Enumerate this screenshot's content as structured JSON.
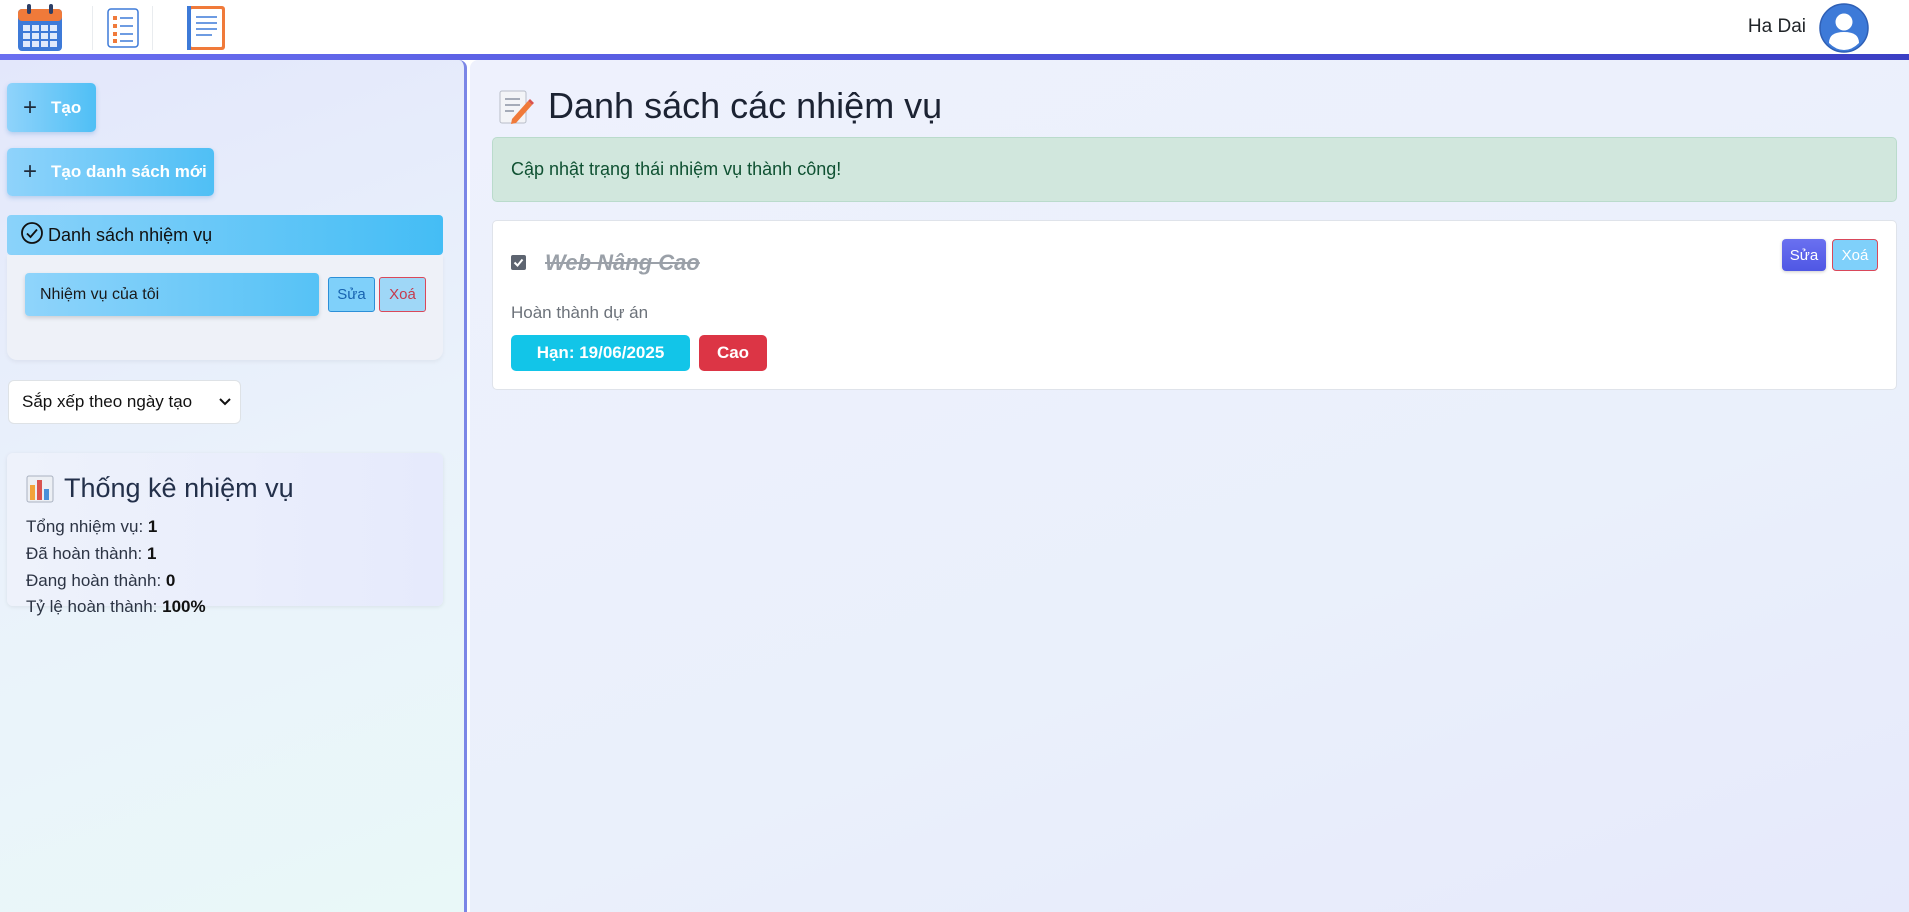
{
  "header": {
    "user_name": "Ha Dai",
    "app_icons": [
      "calendar-icon",
      "checklist-icon",
      "notebook-icon"
    ]
  },
  "sidebar": {
    "create_label": "Tạo",
    "create_list_label": "Tạo danh sách mới",
    "list_section_title": "Danh sách nhiệm vụ",
    "lists": [
      {
        "name": "Nhiệm vụ của tôi",
        "edit_label": "Sửa",
        "delete_label": "Xoá"
      }
    ],
    "sort": {
      "selected": "Sắp xếp theo ngày tạo"
    },
    "stats": {
      "title": "Thống kê nhiệm vụ",
      "total_label": "Tổng nhiệm vụ:",
      "total_value": "1",
      "done_label": "Đã hoàn thành:",
      "done_value": "1",
      "in_progress_label": "Đang hoàn thành:",
      "in_progress_value": "0",
      "rate_label": "Tỷ lệ hoàn thành:",
      "rate_value": "100%"
    }
  },
  "main": {
    "title": "Danh sách các nhiệm vụ",
    "alert": "Cập nhật trạng thái nhiệm vụ thành công!",
    "tasks": [
      {
        "title": "Web Nâng Cao",
        "completed": true,
        "description": "Hoàn thành dự án",
        "deadline": "Hạn: 19/06/2025",
        "priority": "Cao",
        "edit_label": "Sửa",
        "delete_label": "Xoá"
      }
    ]
  },
  "colors": {
    "accent": "#4fbff5",
    "header_line": "#4a4fd8",
    "success_bg": "#d1e7dd",
    "deadline_badge": "#12c5e8",
    "priority_badge": "#dc3545"
  }
}
